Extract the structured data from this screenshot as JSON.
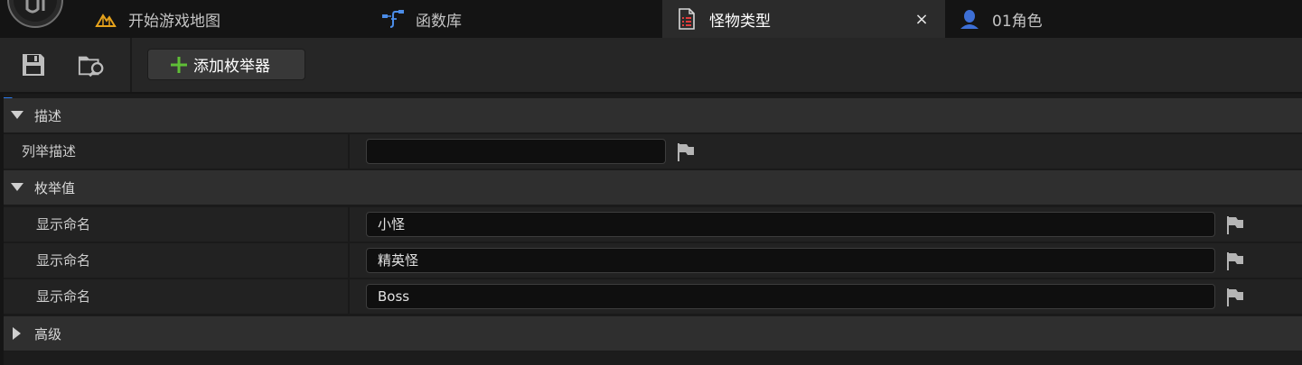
{
  "tabs": [
    {
      "label": "开始游戏地图",
      "icon": "level-map-icon",
      "active": false
    },
    {
      "label": "函数库",
      "icon": "function-library-icon",
      "active": false
    },
    {
      "label": "怪物类型",
      "icon": "enum-asset-icon",
      "active": true
    },
    {
      "label": "01角色",
      "icon": "character-blueprint-icon",
      "active": false
    }
  ],
  "tab_close_glyph": "×",
  "toolbar": {
    "save_icon": "save-icon",
    "browse_icon": "browse-in-content-icon",
    "add_enumerator_label": "添加枚举器"
  },
  "details": {
    "description_category": "描述",
    "enum_description_label": "列举描述",
    "enum_description_value": "",
    "enum_values_category": "枚举值",
    "enumerators": [
      {
        "label": "显示命名",
        "value": "小怪"
      },
      {
        "label": "显示命名",
        "value": "精英怪"
      },
      {
        "label": "显示命名",
        "value": "Boss"
      }
    ],
    "advanced_category": "高级"
  },
  "colors": {
    "accent_blue": "#2a7cf0",
    "plus_green": "#5fbf36",
    "level_icon_orange": "#e5a21c",
    "function_icon_blue": "#4b8de8",
    "character_icon_blue": "#3d6fd6"
  }
}
